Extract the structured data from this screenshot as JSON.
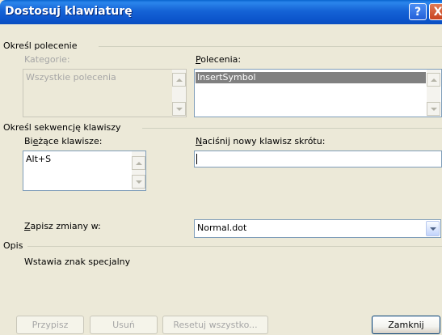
{
  "window": {
    "title": "Dostosuj klawiaturę",
    "help_label": "?",
    "close_label": "X"
  },
  "specify_command": {
    "heading": "Określ polecenie",
    "categories_label": "Kategorie:",
    "categories_items": [
      "Wszystkie polecenia"
    ],
    "commands_label_prefix": "",
    "commands_label_mnemonic": "P",
    "commands_label_rest": "olecenia:",
    "commands_items": [
      "InsertSymbol"
    ]
  },
  "key_sequence": {
    "heading": "Określ sekwencję klawiszy",
    "current_keys_label_pre": "Bi",
    "current_keys_label_mnemonic": "e",
    "current_keys_label_rest": "żące klawisze:",
    "current_keys_items": [
      "Alt+S"
    ],
    "new_key_label_mnemonic": "N",
    "new_key_label_rest": "aciśnij nowy klawisz skrótu:",
    "new_key_value": ""
  },
  "save_in": {
    "label_mnemonic": "Z",
    "label_rest": "apisz zmiany w:",
    "selected": "Normal.dot"
  },
  "description": {
    "heading": "Opis",
    "text": "Wstawia znak specjalny"
  },
  "buttons": {
    "assign": "Przypisz",
    "remove": "Usuń",
    "reset_all": "Resetuj wszystko...",
    "close": "Zamknij"
  }
}
